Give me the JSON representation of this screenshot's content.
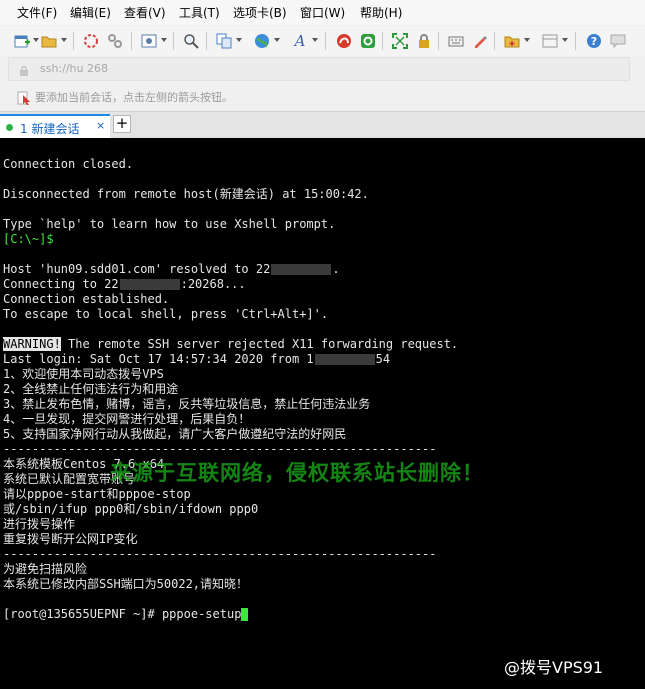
{
  "menu": [
    {
      "label": "文件(F)",
      "key": "file"
    },
    {
      "label": "编辑(E)",
      "key": "edit"
    },
    {
      "label": "查看(V)",
      "key": "view"
    },
    {
      "label": "工具(T)",
      "key": "tools"
    },
    {
      "label": "选项卡(B)",
      "key": "tabs"
    },
    {
      "label": "窗口(W)",
      "key": "window"
    },
    {
      "label": "帮助(H)",
      "key": "help"
    }
  ],
  "toolbar_icons": [
    "new-session-icon",
    "open-folder-icon",
    "connect-icon",
    "disconnect-icon",
    "properties-icon",
    "find-icon",
    "copy-icon",
    "globe-icon",
    "font-icon",
    "xshell-red-icon",
    "xftp-green-icon",
    "fullscreen-icon",
    "lock-icon",
    "keyboard-icon",
    "highlight-icon",
    "compose-icon",
    "layout-icon",
    "help-icon",
    "chat-icon"
  ],
  "address": {
    "value": "ssh://hu                    268",
    "lock_icon": "lock-icon"
  },
  "hint": {
    "text": "要添加当前会话，点击左侧的箭头按钮。"
  },
  "tab": {
    "label": "1 新建会话",
    "close": "×",
    "new_tab": "+",
    "status_color": "#2db34a"
  },
  "terminal": {
    "l1": "Connection closed.",
    "l2": "Disconnected from remote host(新建会话) at 15:00:42.",
    "l3": "Type `help' to learn how to use Xshell prompt.",
    "l4": "[C:\\~]$",
    "l5a": "Host 'hun09.sdd01.com' resolved to 22",
    "l5b": ".",
    "l6a": "Connecting to 22",
    "l6b": ":20268...",
    "l7": "Connection established.",
    "l8": "To escape to local shell, press 'Ctrl+Alt+]'.",
    "l9a": "WARNING!",
    "l9b": " The remote SSH server rejected X11 forwarding request.",
    "l10a": "Last login: Sat Oct 17 14:57:34 2020 from 1",
    "l10b": "54",
    "l11": "1、欢迎使用本司动态拨号VPS",
    "l12": "2、全线禁止任何违法行为和用途",
    "l13": "3、禁止发布色情，赌博，谣言，反共等垃圾信息，禁止任何违法业务",
    "l14": "4、一旦发现，提交网警进行处理，后果自负！",
    "l15": "5、支持国家净网行动从我做起，请广大客户做遵纪守法的好网民",
    "l16": "------------------------------------------------------------",
    "l17": "本系统模板Centos 7.6 x64",
    "l18": "系统已默认配置宽带账号",
    "l19": "请以pppoe-start和pppoe-stop",
    "l20": "或/sbin/ifup ppp0和/sbin/ifdown ppp0",
    "l21": "进行拨号操作",
    "l22": "重复拨号断开公网IP变化",
    "l23": "------------------------------------------------------------",
    "l24": "为避免扫描风险",
    "l25": "本系统已修改内部SSH端口为50022,请知晓！",
    "l26": "[root@135655UEPNF ~]# pppoe-setup"
  },
  "watermark": "来源于互联网络，侵权联系站长删除！",
  "brand": "@拨号VPS91",
  "colors": {
    "prompt_green": "#3ee63e",
    "terminal_bg": "#000000",
    "terminal_fg": "#e6e6e6",
    "tab_accent": "#1e88e5"
  }
}
